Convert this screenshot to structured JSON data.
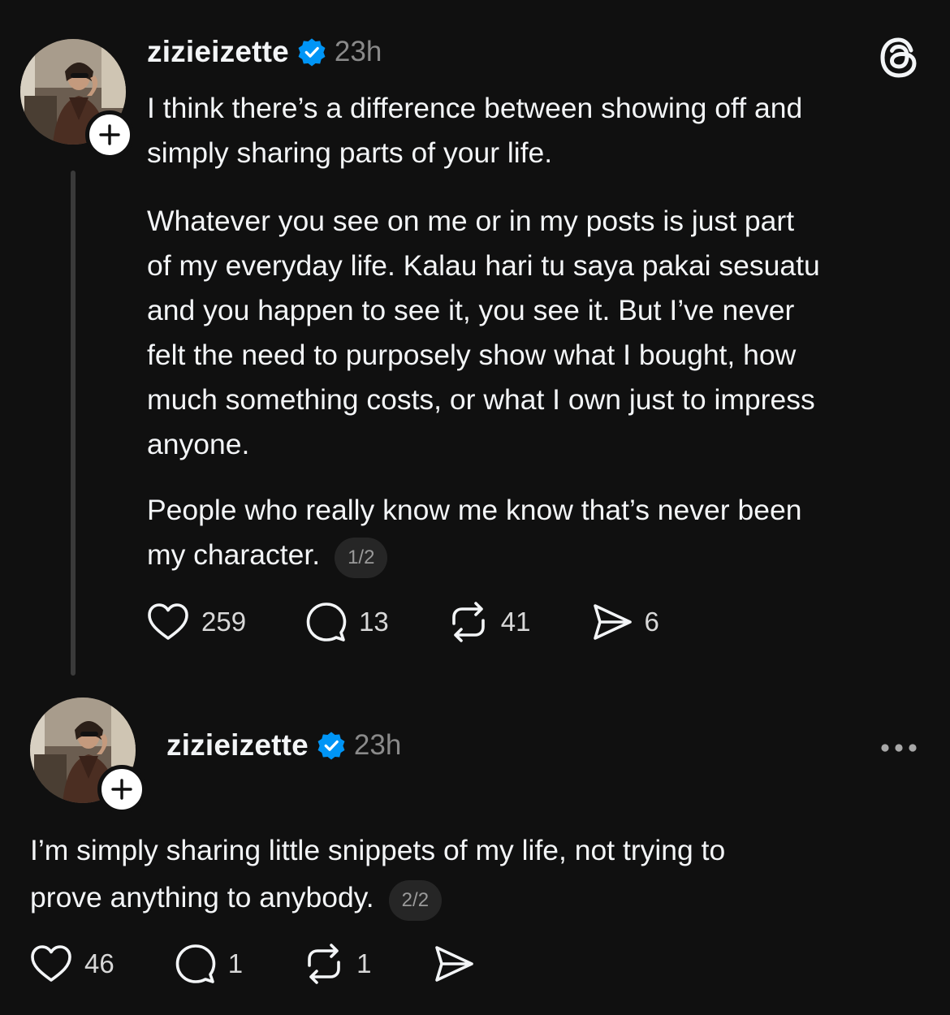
{
  "post1": {
    "avatar_label": "zizieizette avatar",
    "username": "zizieizette",
    "time": "23h",
    "paragraphs": [
      "I think there’s a difference between showing off and\nsimply sharing parts of your life.",
      "Whatever you see on me or in my posts is just part\nof my everyday life. Kalau hari tu saya pakai sesuatu\nand you happen to see it, you see it. But I’ve never\nfelt the need to purposely show what I bought, how\nmuch something costs, or what I own just to impress\nanyone.",
      "People who really know me know that’s never been\nmy character."
    ],
    "pager": "1/2",
    "likes": "259",
    "replies": "13",
    "reposts": "41",
    "shares": "6"
  },
  "post2": {
    "username": "zizieizette",
    "time": "23h",
    "text": "I’m simply sharing little snippets of my life, not trying to\nprove anything to anybody.",
    "pager": "2/2",
    "likes": "46",
    "replies": "1",
    "reposts": "1"
  },
  "icons": {
    "app_logo": "threads-logo-icon",
    "verified": "verified-badge-icon",
    "follow": "plus-icon",
    "like": "heart-icon",
    "reply": "comment-icon",
    "repost": "repost-icon",
    "share": "send-icon",
    "more": "more-dots-icon"
  },
  "colors": {
    "background": "#101010",
    "verified_blue": "#0095f6",
    "text": "#f3f5f7",
    "muted": "#8a8a8a"
  }
}
